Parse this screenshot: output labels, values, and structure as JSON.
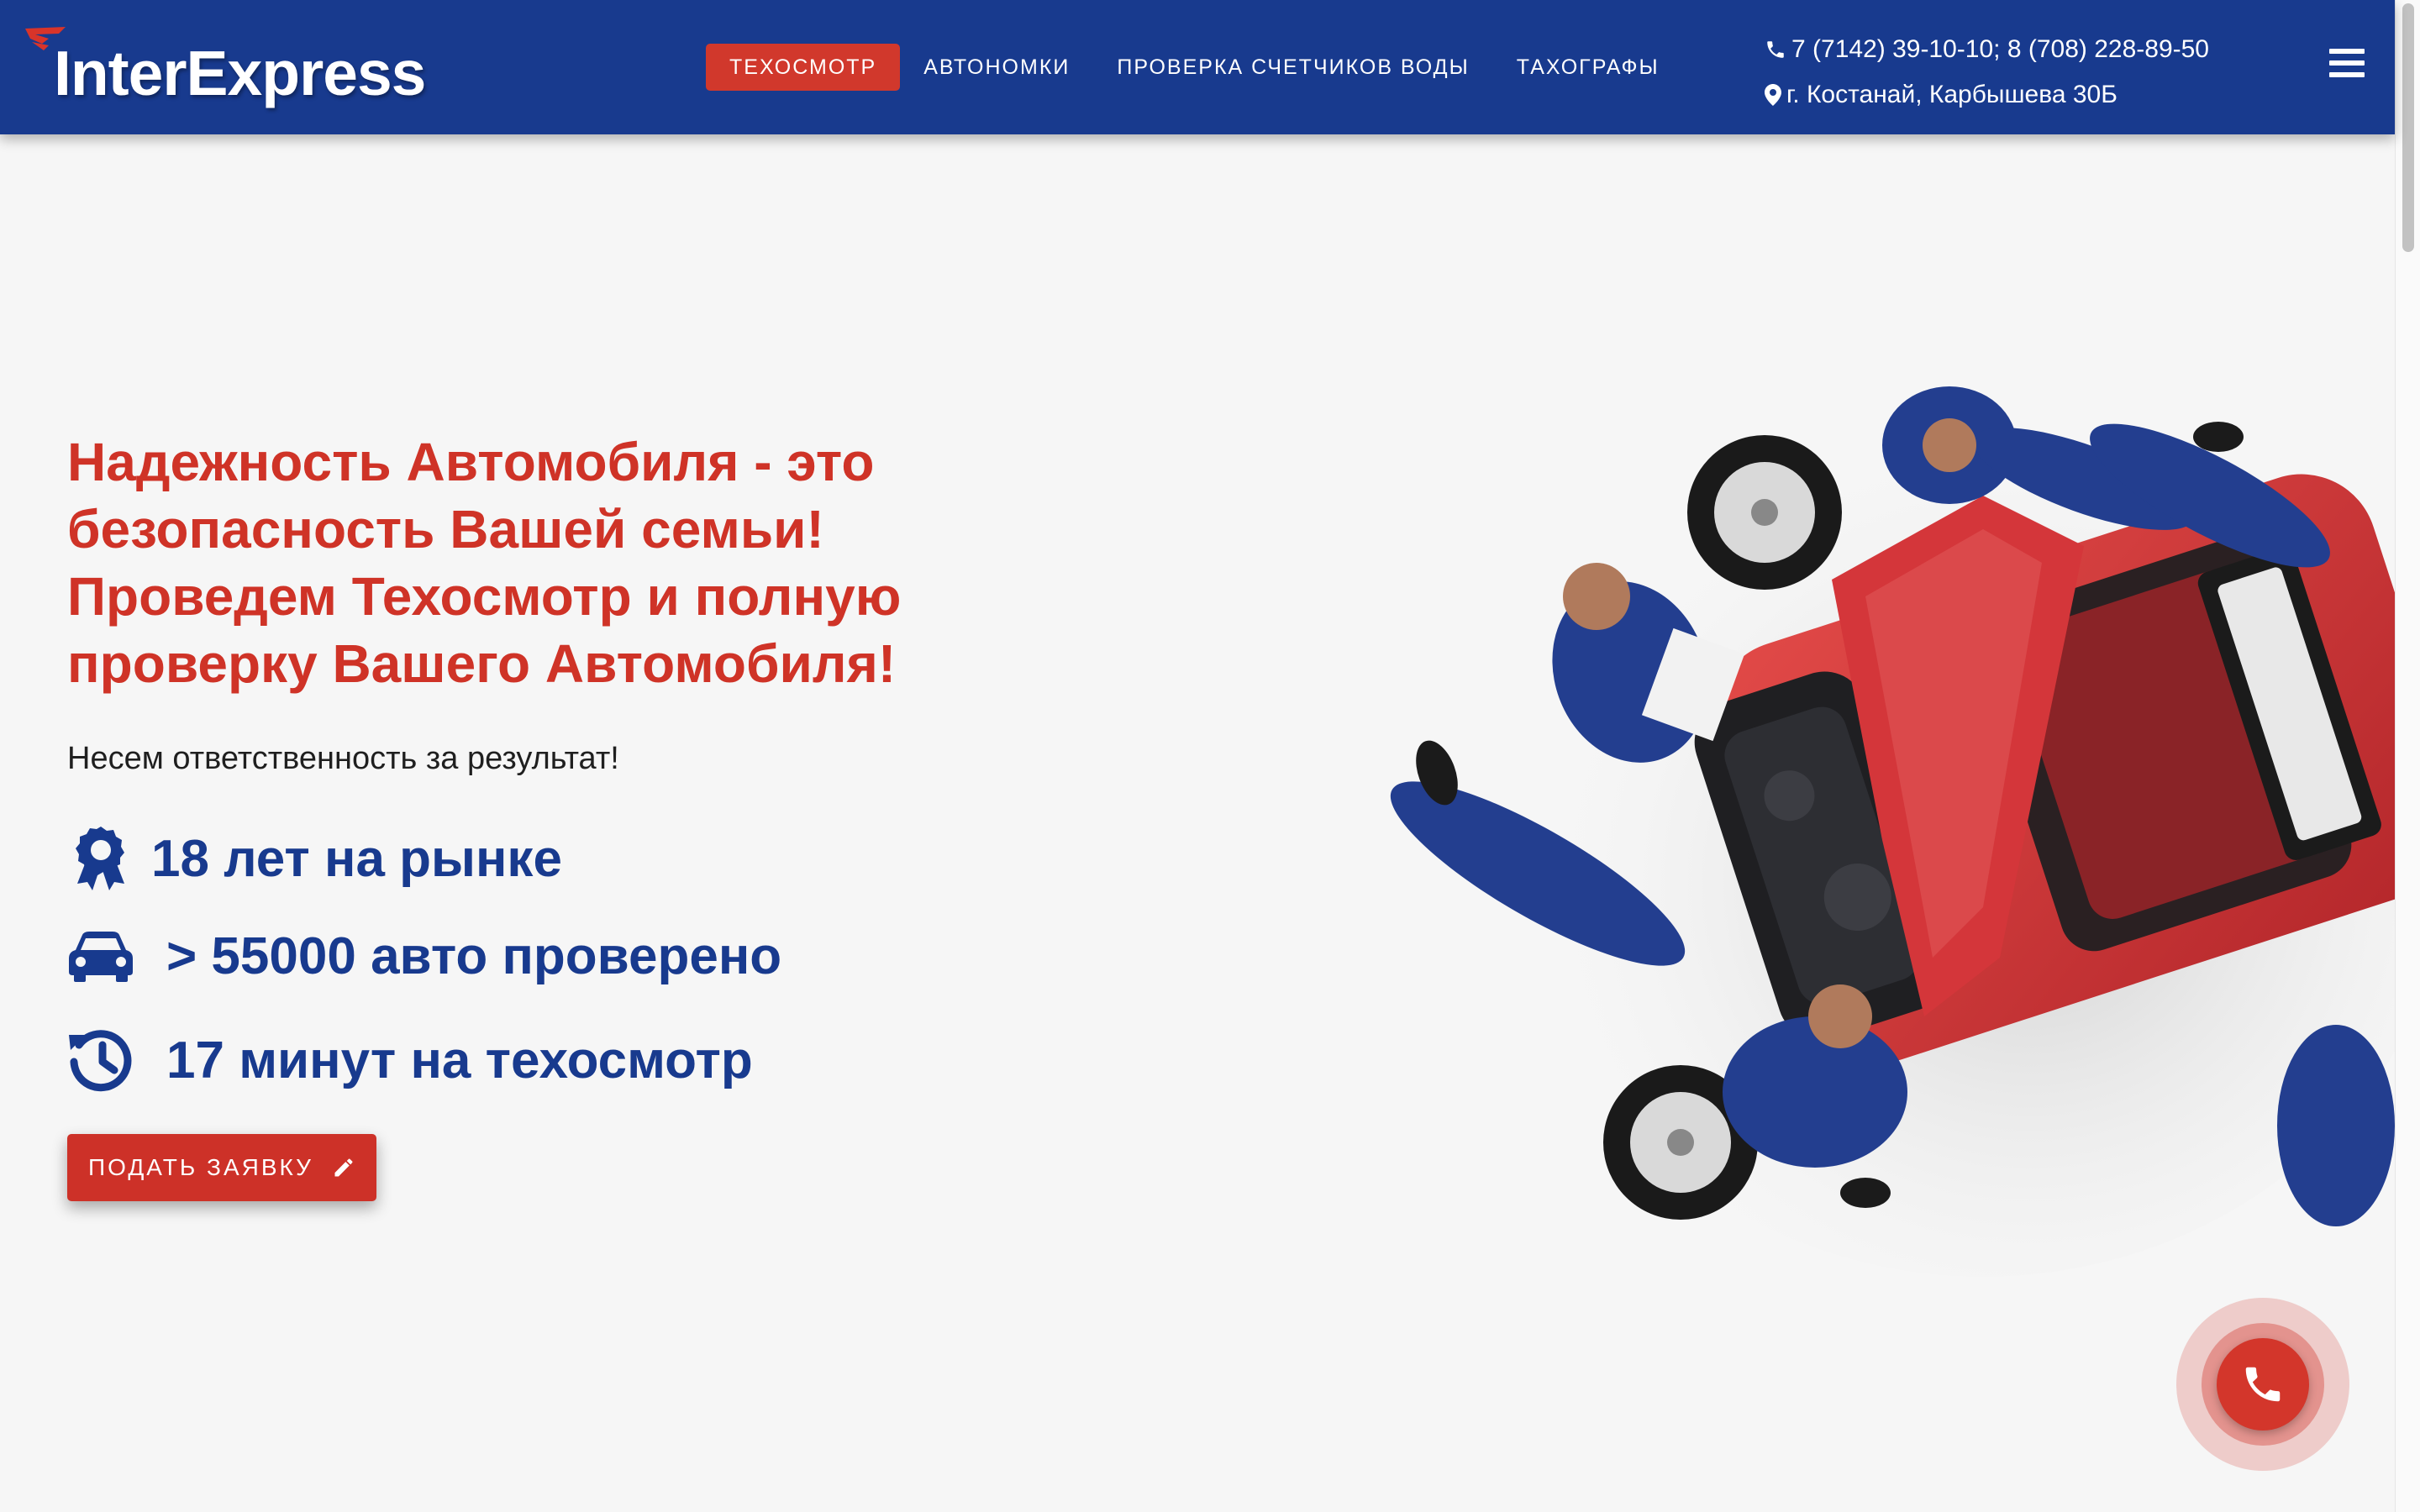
{
  "header": {
    "logo_text": "InterExpress",
    "nav": [
      {
        "label": "ТЕХОСМОТР",
        "active": true
      },
      {
        "label": "АВТОНОМКИ",
        "active": false
      },
      {
        "label": "ПРОВЕРКА СЧЕТЧИКОВ ВОДЫ",
        "active": false
      },
      {
        "label": "ТАХОГРАФЫ",
        "active": false
      }
    ],
    "phone": "7 (7142) 39-10-10; 8 (708) 228-89-50",
    "address": "г. Костанай, Карбышева 30Б",
    "phone_icon": "phone-icon",
    "address_icon": "map-marker-icon",
    "menu_icon": "hamburger-menu-icon"
  },
  "hero": {
    "headline": "Надежность Автомобиля - это безопасность Вашей семьи! Проведем Техосмотр и полную проверку Вашего Автомобиля!",
    "tagline": "Несем ответственность за результат!",
    "stats": [
      {
        "icon": "award-icon",
        "text": "18 лет на рынке"
      },
      {
        "icon": "car-icon",
        "text": "> 55000 авто проверено"
      },
      {
        "icon": "history-clock-icon",
        "text": "17 минут на техосмотр"
      }
    ],
    "cta_label": "ПОДАТЬ ЗАЯВКУ",
    "cta_icon": "pencil-icon",
    "illustration": "mechanics-inspecting-red-car"
  },
  "floating": {
    "call_icon": "phone-icon"
  },
  "colors": {
    "header_bg": "#183a8e",
    "accent_red": "#d1382c",
    "stat_blue": "#183a8e",
    "page_bg": "#f6f6f6"
  }
}
